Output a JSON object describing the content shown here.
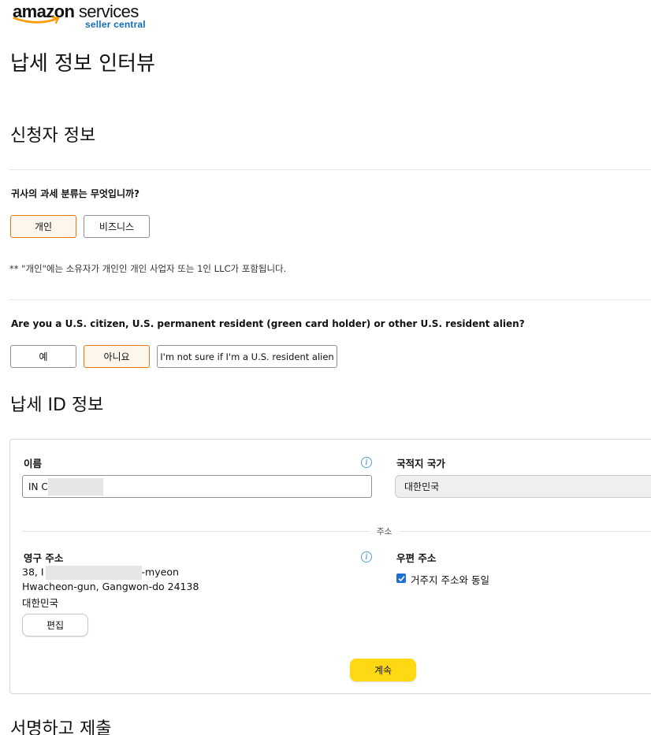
{
  "logo": {
    "brand_bold": "amazon",
    "brand_light": "services",
    "sub": "seller central"
  },
  "page_title": "납세 정보 인터뷰",
  "section_applicant": {
    "title": "신청자 정보",
    "q_tax_class": "귀사의 과세 분류는 무엇입니까?",
    "tax_class_options": [
      "개인",
      "비즈니스"
    ],
    "tax_class_selected": "개인",
    "note": "** \"개인\"에는 소유자가 개인인 개인 사업자 또는 1인 LLC가 포함됩니다.",
    "q_us_person": "Are you a U.S. citizen, U.S. permanent resident (green card holder) or other U.S. resident alien?",
    "us_person_options": [
      "예",
      "아니요",
      "I'm not sure if I'm a U.S. resident alien"
    ],
    "us_person_selected": "아니요"
  },
  "section_tax_id": {
    "title": "납세 ID 정보",
    "name_label": "이름",
    "name_value_prefix": "IN C",
    "country_label": "국적지 국가",
    "country_value": "대한민국",
    "address_separator": "주소",
    "permanent_address_label": "영구 주소",
    "address_line1_prefix": "38, I",
    "address_line1_suffix": "-myeon",
    "address_line2": "Hwacheon-gun, Gangwon-do 24138",
    "address_line3": "대한민국",
    "edit_button": "편집",
    "mailing_address_label": "우편 주소",
    "same_as_residence_label": "거주지 주소와 동일",
    "same_as_residence_checked": true,
    "continue_button": "계속"
  },
  "section_sign": {
    "title": "서명하고 제출"
  },
  "colors": {
    "selected_border": "#e47911",
    "selected_bg": "#fdf6ec",
    "primary_button": "#ffd814",
    "checkbox": "#1f6fd1",
    "info_icon": "#3b82c4"
  }
}
